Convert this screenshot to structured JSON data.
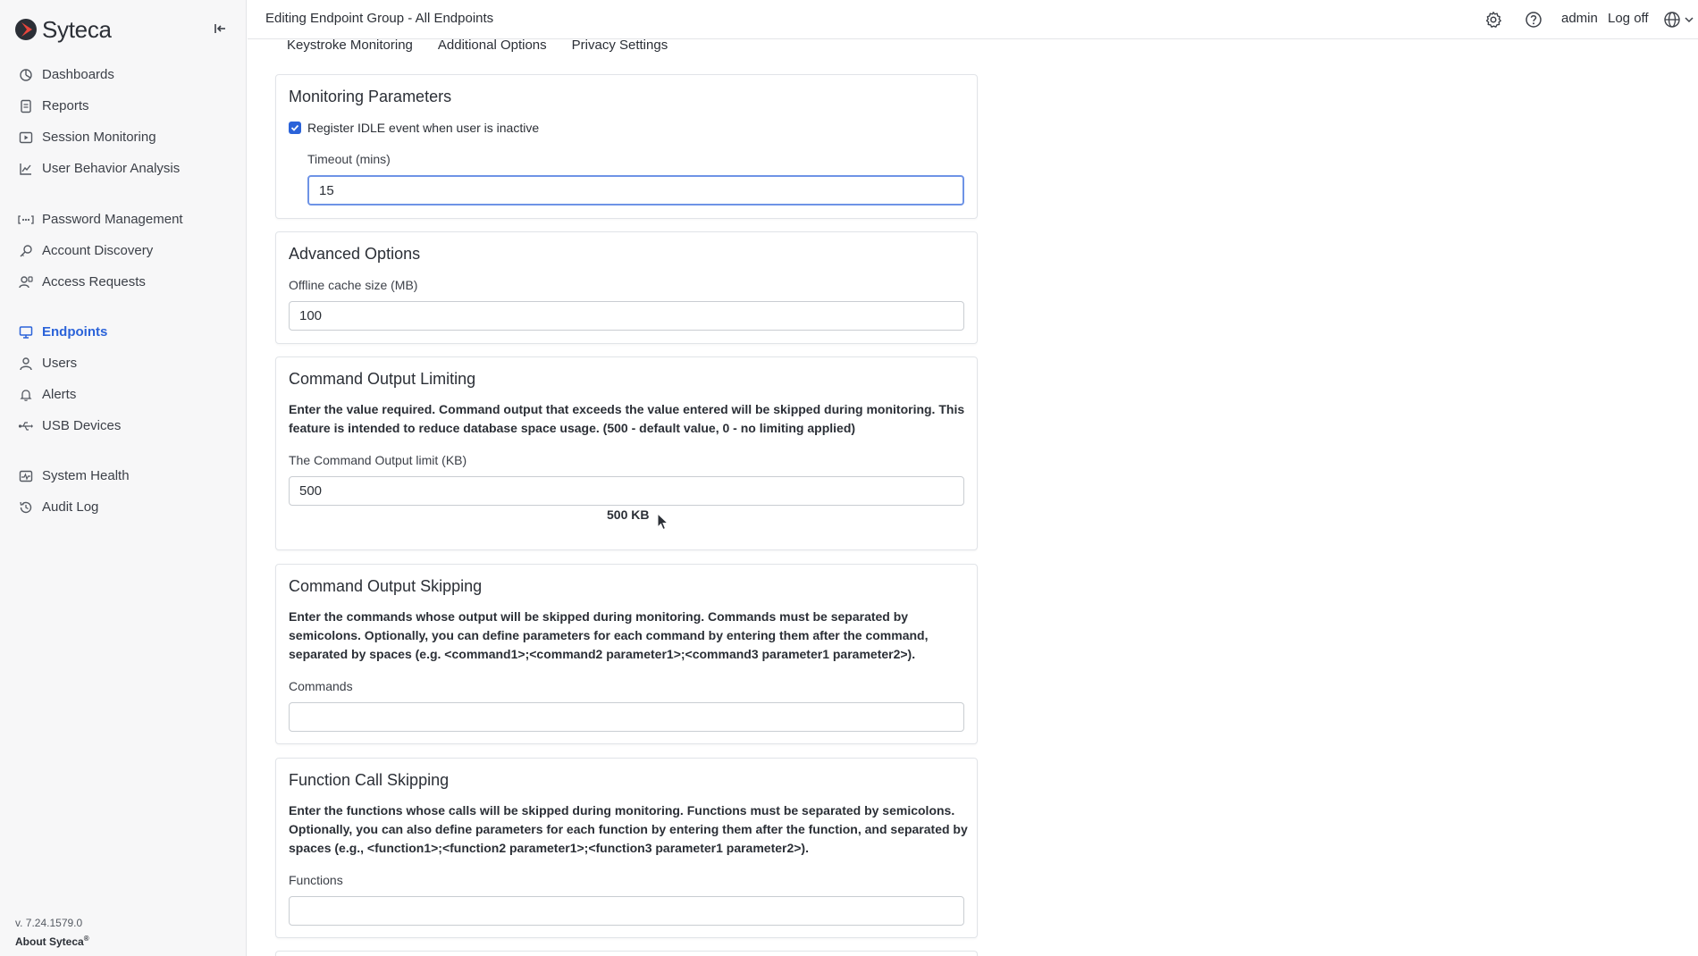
{
  "app": {
    "brand": "Syteca",
    "version": "v. 7.24.1579.0",
    "about": "About Syteca",
    "about_mark": "®"
  },
  "colors": {
    "accent": "#2b63d9",
    "logo_red": "#e8453c",
    "logo_dark": "#2b2f36"
  },
  "sidebar": {
    "groups": [
      [
        {
          "label": "Dashboards",
          "icon": "dashboard-icon"
        },
        {
          "label": "Reports",
          "icon": "report-icon"
        },
        {
          "label": "Session Monitoring",
          "icon": "session-icon"
        },
        {
          "label": "User Behavior Analysis",
          "icon": "chart-icon"
        }
      ],
      [
        {
          "label": "Password Management",
          "icon": "password-icon"
        },
        {
          "label": "Account Discovery",
          "icon": "discovery-icon"
        },
        {
          "label": "Access Requests",
          "icon": "access-icon"
        }
      ],
      [
        {
          "label": "Endpoints",
          "icon": "monitor-icon",
          "active": true
        },
        {
          "label": "Users",
          "icon": "user-icon"
        },
        {
          "label": "Alerts",
          "icon": "bell-icon"
        },
        {
          "label": "USB Devices",
          "icon": "usb-icon"
        }
      ],
      [
        {
          "label": "System Health",
          "icon": "health-icon"
        },
        {
          "label": "Audit Log",
          "icon": "history-icon"
        }
      ]
    ]
  },
  "header": {
    "title": "Editing Endpoint Group - All Endpoints",
    "user": "admin",
    "logoff": "Log off"
  },
  "tabs": [
    "Keystroke Monitoring",
    "Additional Options",
    "Privacy Settings"
  ],
  "monitoring": {
    "title": "Monitoring Parameters",
    "idle_checkbox_label": "Register IDLE event when user is inactive",
    "idle_checked": true,
    "timeout_label": "Timeout (mins)",
    "timeout_value": "15"
  },
  "advanced": {
    "title": "Advanced Options",
    "cache_label": "Offline cache size (MB)",
    "cache_value": "100"
  },
  "output_limiting": {
    "title": "Command Output Limiting",
    "description": "Enter the value required. Command output that exceeds the value entered will be skipped during monitoring. This feature is intended to reduce database space usage. (500 - default value, 0 - no limiting applied)",
    "limit_label": "The Command Output limit (KB)",
    "limit_value": "500",
    "limit_hint": "500 KB"
  },
  "output_skipping": {
    "title": "Command Output Skipping",
    "description": "Enter the commands whose output will be skipped during monitoring. Commands must be separated by semicolons. Optionally, you can define parameters for each command by entering them after the command, separated by spaces (e.g. <command1>;<command2 parameter1>;<command3 parameter1 parameter2>).",
    "commands_label": "Commands",
    "commands_value": ""
  },
  "function_skipping": {
    "title": "Function Call Skipping",
    "description": "Enter the functions whose calls will be skipped during monitoring. Functions must be separated by semicolons. Optionally, you can also define parameters for each function by entering them after the function, and separated by spaces (e.g., <function1>;<function2 parameter1>;<function3 parameter1 parameter2>).",
    "functions_label": "Functions",
    "functions_value": ""
  }
}
